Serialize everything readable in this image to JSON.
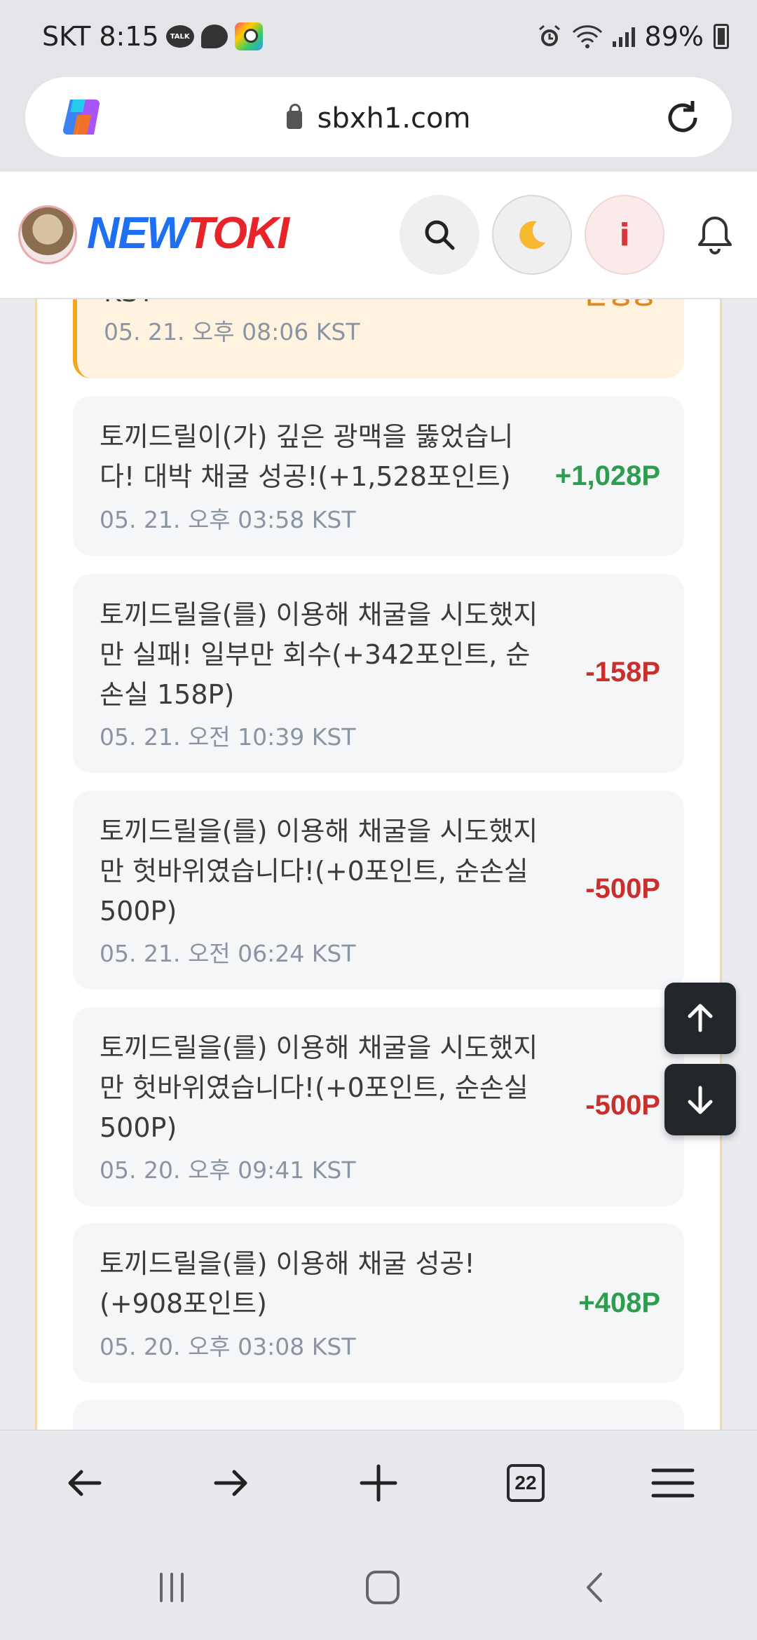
{
  "status_bar": {
    "carrier_time": "SKT 8:15",
    "talk_icon_text": "TALK",
    "battery": "89%"
  },
  "browser": {
    "url": "sbxh1.com",
    "tab_count": "22"
  },
  "site": {
    "logo_new": "NEW",
    "logo_toki": "TOKI",
    "info_label": "i"
  },
  "partial_card": {
    "text_fragment": "KST",
    "status": "진행중",
    "date": "05. 21. 오후 08:06 KST"
  },
  "entries": [
    {
      "text": "토끼드릴이(가) 깊은 광맥을 뚫었습니다! 대박 채굴 성공!(+1,528포인트)",
      "date": "05. 21. 오후 03:58 KST",
      "amount": "+1,028P",
      "type": "positive"
    },
    {
      "text": "토끼드릴을(를) 이용해 채굴을 시도했지만 실패! 일부만 회수(+342포인트, 순손실 158P)",
      "date": "05. 21. 오전 10:39 KST",
      "amount": "-158P",
      "type": "negative"
    },
    {
      "text": "토끼드릴을(를) 이용해 채굴을 시도했지만 헛바위였습니다!(+0포인트, 순손실 500P)",
      "date": "05. 21. 오전 06:24 KST",
      "amount": "-500P",
      "type": "negative"
    },
    {
      "text": "토끼드릴을(를) 이용해 채굴을 시도했지만 헛바위였습니다!(+0포인트, 순손실 500P)",
      "date": "05. 20. 오후 09:41 KST",
      "amount": "-500P",
      "type": "negative"
    },
    {
      "text": "토끼드릴을(를) 이용해 채굴 성공!(+908포인트)",
      "date": "05. 20. 오후 03:08 KST",
      "amount": "+408P",
      "type": "positive"
    }
  ],
  "colors": {
    "positive": "#2e9d4f",
    "negative": "#c9302c",
    "accent_orange": "#f5a623",
    "logo_blue": "#1f6ff2",
    "logo_red": "#e8242b"
  },
  "icons": [
    "kakaotalk-icon",
    "chat-icon",
    "map-icon",
    "alarm-icon",
    "wifi-icon",
    "signal-icon",
    "battery-icon",
    "copilot-icon",
    "lock-icon",
    "reload-icon",
    "search-icon",
    "moon-icon",
    "info-icon",
    "bell-icon",
    "arrow-up-icon",
    "arrow-down-icon",
    "back-icon",
    "forward-icon",
    "plus-icon",
    "tabs-icon",
    "menu-icon",
    "recent-apps-icon",
    "home-icon",
    "nav-back-icon"
  ]
}
